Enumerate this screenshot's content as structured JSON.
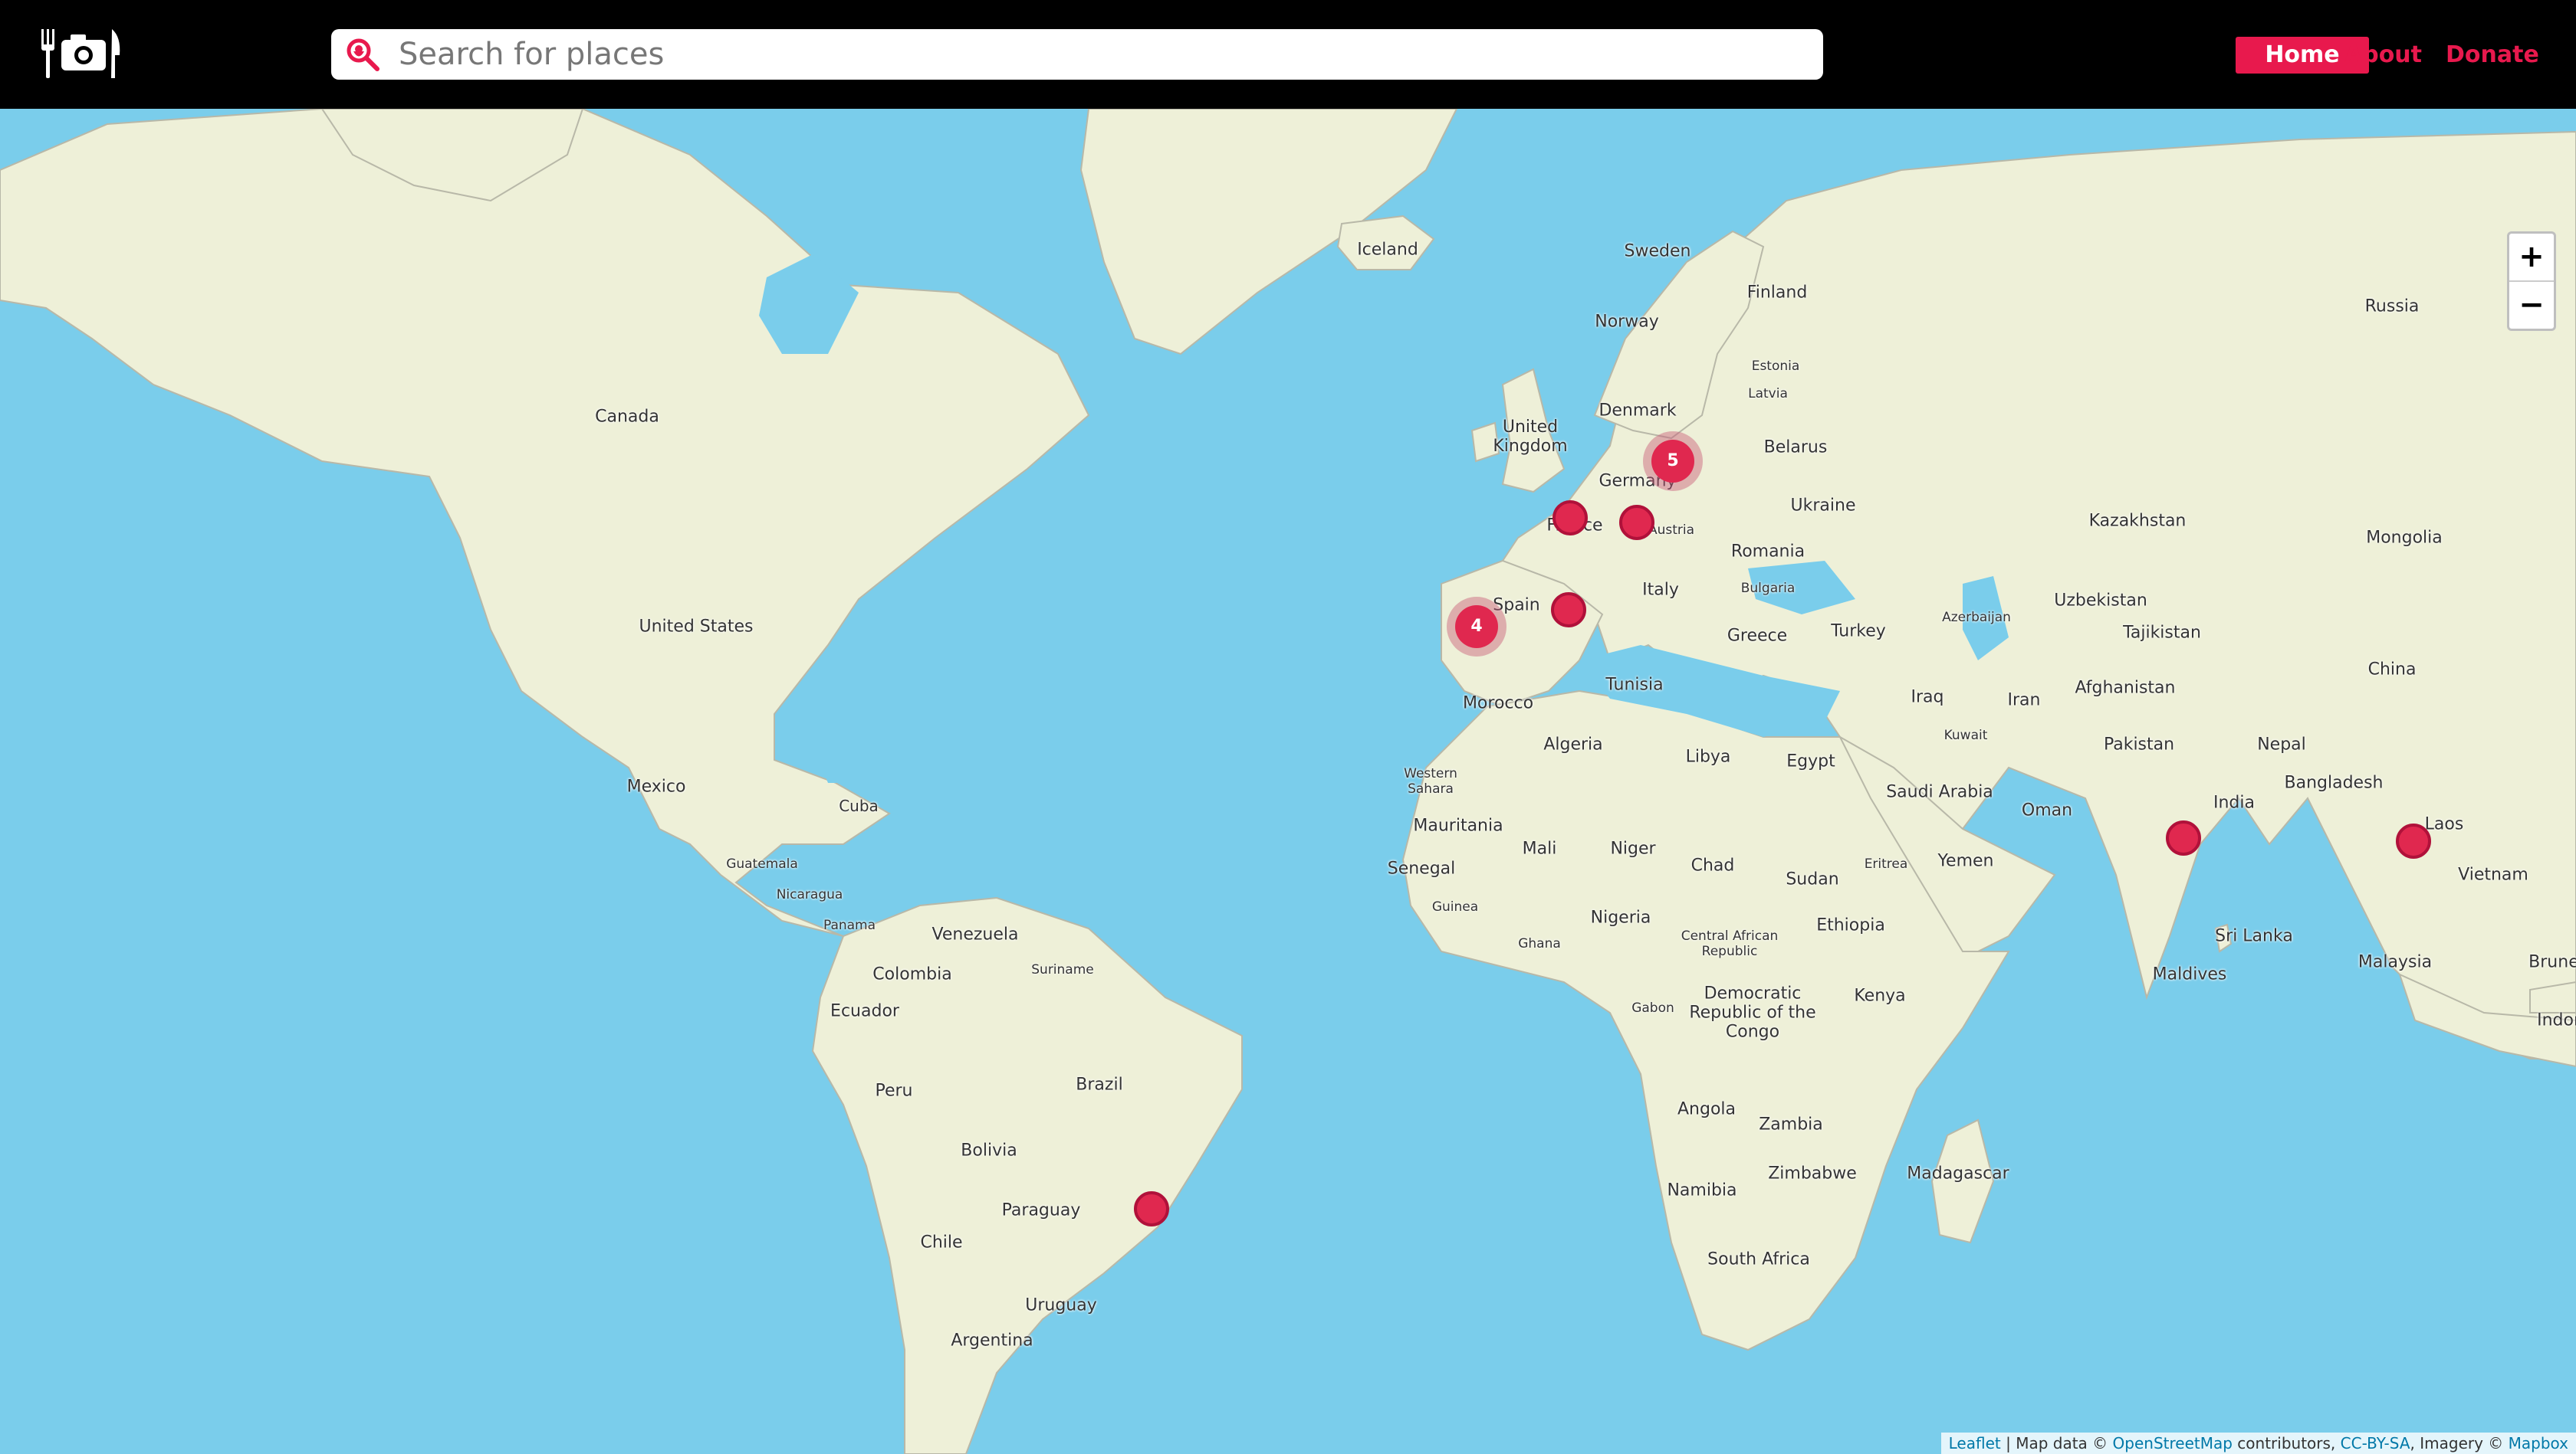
{
  "header": {
    "logo_icon": "fork-camera-knife-icon",
    "search_icon": "search-pin-icon",
    "search_placeholder": "Search for places",
    "nav": {
      "home": "Home",
      "about": "About",
      "donate": "Donate"
    },
    "accent_color": "#e8194d"
  },
  "map": {
    "water_color": "#7acdeb",
    "land_color": "#eef0d8",
    "zoom": {
      "in": "+",
      "out": "−"
    },
    "clusters": {
      "europe_north": "5",
      "iberia": "4"
    },
    "labels": {
      "canada": "Canada",
      "united_states": "United States",
      "mexico": "Mexico",
      "cuba": "Cuba",
      "guatemala": "Guatemala",
      "nicaragua": "Nicaragua",
      "panama": "Panama",
      "venezuela": "Venezuela",
      "colombia": "Colombia",
      "suriname": "Suriname",
      "ecuador": "Ecuador",
      "peru": "Peru",
      "brazil": "Brazil",
      "bolivia": "Bolivia",
      "paraguay": "Paraguay",
      "chile": "Chile",
      "uruguay": "Uruguay",
      "argentina": "Argentina",
      "iceland": "Iceland",
      "sweden": "Sweden",
      "finland": "Finland",
      "norway": "Norway",
      "estonia": "Estonia",
      "latvia": "Latvia",
      "denmark": "Denmark",
      "united_kingdom": "United Kingdom",
      "belarus": "Belarus",
      "germany": "Germany",
      "ukraine": "Ukraine",
      "france": "France",
      "austria": "Austria",
      "romania": "Romania",
      "italy": "Italy",
      "bulgaria": "Bulgaria",
      "spain": "Spain",
      "greece": "Greece",
      "turkey": "Turkey",
      "azerbaijan": "Azerbaijan",
      "russia": "Russia",
      "kazakhstan": "Kazakhstan",
      "mongolia": "Mongolia",
      "uzbekistan": "Uzbekistan",
      "tajikistan": "Tajikistan",
      "china": "China",
      "afghanistan": "Afghanistan",
      "iraq": "Iraq",
      "iran": "Iran",
      "kuwait": "Kuwait",
      "pakistan": "Pakistan",
      "nepal": "Nepal",
      "bangladesh": "Bangladesh",
      "india": "India",
      "laos": "Laos",
      "vietnam": "Vietnam",
      "sri_lanka": "Sri Lanka",
      "maldives": "Maldives",
      "malaysia": "Malaysia",
      "brunei": "Brunei",
      "indonesia": "Indon",
      "tunisia": "Tunisia",
      "morocco": "Morocco",
      "algeria": "Algeria",
      "libya": "Libya",
      "egypt": "Egypt",
      "western_sahara": "Western Sahara",
      "saudi_arabia": "Saudi Arabia",
      "oman": "Oman",
      "mauritania": "Mauritania",
      "mali": "Mali",
      "niger": "Niger",
      "chad": "Chad",
      "sudan": "Sudan",
      "eritrea": "Eritrea",
      "yemen": "Yemen",
      "senegal": "Senegal",
      "guinea": "Guinea",
      "ghana": "Ghana",
      "nigeria": "Nigeria",
      "ethiopia": "Ethiopia",
      "central_african_republic": "Central African Republic",
      "gabon": "Gabon",
      "drc": "Democratic Republic of the Congo",
      "kenya": "Kenya",
      "angola": "Angola",
      "zambia": "Zambia",
      "zimbabwe": "Zimbabwe",
      "namibia": "Namibia",
      "madagascar": "Madagascar",
      "south_africa": "South Africa"
    }
  },
  "attribution": {
    "leaflet": "Leaflet",
    "sep": " | Map data © ",
    "osm": "OpenStreetMap",
    "contributors": " contributors, ",
    "license": "CC-BY-SA",
    "imagery": ", Imagery © ",
    "mapbox": "Mapbox"
  }
}
